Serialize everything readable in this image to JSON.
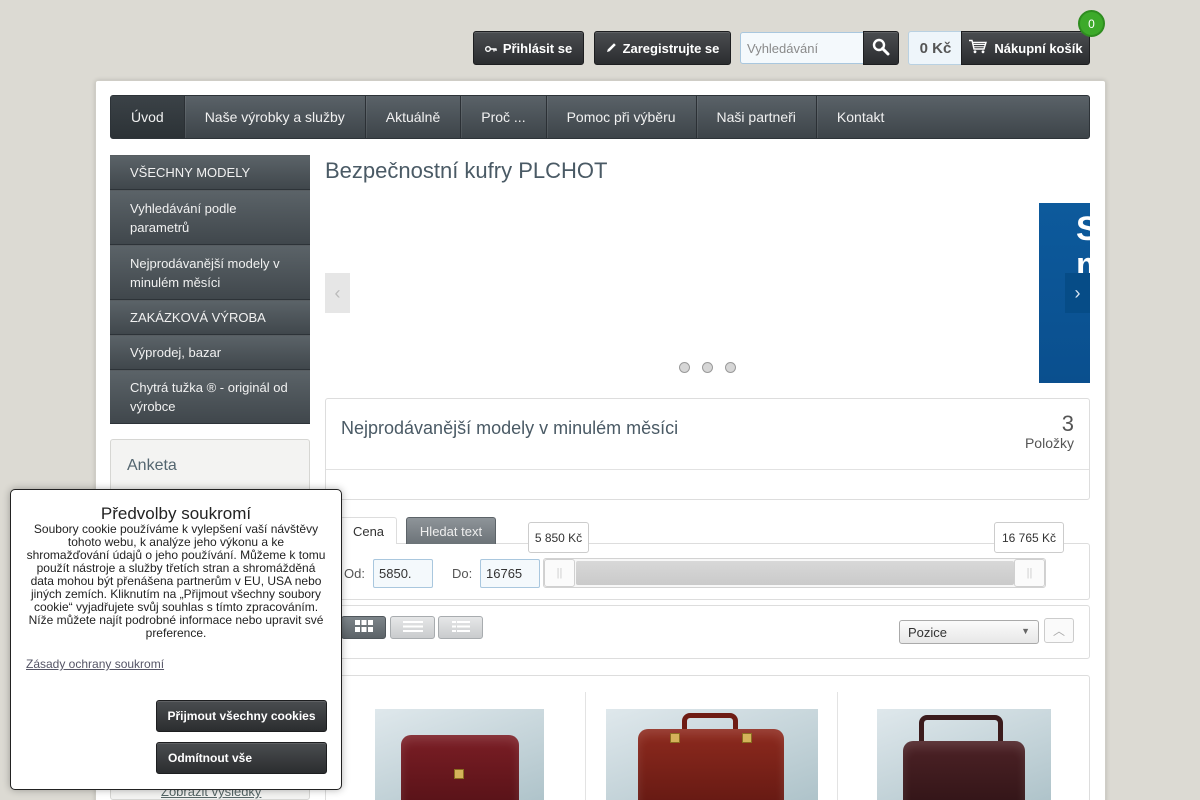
{
  "header": {
    "login_label": "Přihlásit se",
    "register_label": "Zaregistrujte se",
    "search_placeholder": "Vyhledávání",
    "cart_price": "0 Kč",
    "cart_label": "Nákupní košík",
    "cart_count": "0"
  },
  "nav": {
    "items": [
      {
        "label": "Úvod"
      },
      {
        "label": "Naše výrobky a služby"
      },
      {
        "label": "Aktuálně"
      },
      {
        "label": "Proč ..."
      },
      {
        "label": "Pomoc při výběru"
      },
      {
        "label": "Naši partneři"
      },
      {
        "label": "Kontakt"
      }
    ]
  },
  "sidebar": {
    "items": [
      {
        "label": "VŠECHNY MODELY"
      },
      {
        "label": "Vyhledávání podle parametrů"
      },
      {
        "label": "Nejprodávanější modely v minulém měsíci"
      },
      {
        "label": "ZAKÁZKOVÁ VÝROBA"
      },
      {
        "label": "Výprodej, bazar"
      },
      {
        "label": "Chytrá tužka ® - originál od výrobce"
      }
    ],
    "poll_title": "Anketa",
    "poll_link": "Zobrazit výsledky"
  },
  "main": {
    "title": "Bezpečnostní kufry PLCHOT",
    "banner_text": "S\nm",
    "bestsellers": {
      "title": "Nejprodávanější modely v minulém měsíci",
      "count": "3",
      "count_label": "Položky"
    },
    "filter": {
      "tab_price": "Cena",
      "tab_text": "Hledat text",
      "price_min_tip": "5 850 Kč",
      "price_max_tip": "16 765 Kč",
      "label_from": "Od:",
      "label_to": "Do:",
      "value_from": "5850.",
      "value_to": "16765"
    },
    "sort": {
      "selected": "Pozice"
    }
  },
  "cookie": {
    "title": "Předvolby soukromí",
    "text": "Soubory cookie používáme k vylepšení vaší návštěvy tohoto webu, k analýze jeho výkonu a ke shromažďování údajů o jeho používání. Můžeme k tomu použít nástroje a služby třetích stran a shromážděná data mohou být přenášena partnerům v EU, USA nebo jiných zemích. Kliknutím na „Přijmout všechny soubory cookie“ vyjadřujete svůj souhlas s tímto zpracováním. Níže můžete najít podrobné informace nebo upravit své preference.",
    "policy_link": "Zásady ochrany soukromí",
    "accept_label": "Přijmout všechny cookies",
    "reject_label": "Odmítnout vše"
  }
}
